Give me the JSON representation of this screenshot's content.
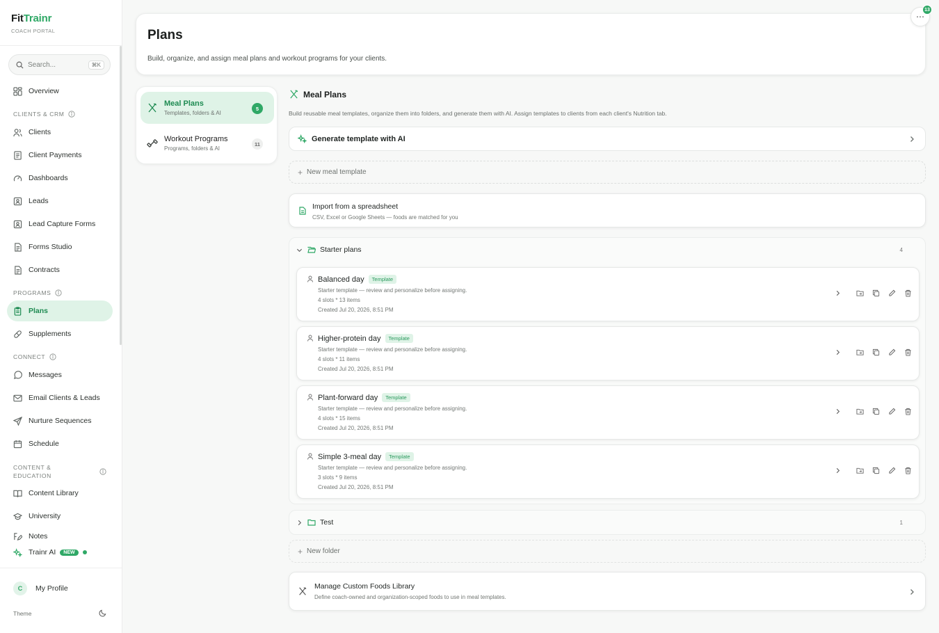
{
  "brand": {
    "name_part1": "Fit",
    "name_part2": "Trainr",
    "subtitle": "COACH PORTAL",
    "accent_color": "#2fa866"
  },
  "search": {
    "placeholder": "Search...",
    "shortcut": "⌘K"
  },
  "sidebar": {
    "overview": "Overview",
    "section_clients": "CLIENTS & CRM",
    "clients_items": [
      "Clients",
      "Client Payments",
      "Dashboards",
      "Leads",
      "Lead Capture Forms",
      "Forms Studio",
      "Contracts"
    ],
    "section_programs": "PROGRAMS",
    "programs_items": [
      "Plans",
      "Supplements"
    ],
    "section_connect": "CONNECT",
    "connect_items": [
      "Messages",
      "Email Clients & Leads",
      "Nurture Sequences",
      "Schedule"
    ],
    "section_content_line1": "CONTENT &",
    "section_content_line2": "EDUCATION",
    "content_items": [
      "Content Library",
      "University",
      "Notes"
    ],
    "trainr_ai": "Trainr AI",
    "new_badge": "NEW",
    "profile_initial": "C",
    "profile_label": "My Profile",
    "theme_label": "Theme"
  },
  "header": {
    "title": "Plans",
    "subtitle": "Build, organize, and assign meal plans and workout programs for your clients.",
    "more_icon": "ellipsis-icon",
    "notification_count": "13"
  },
  "tabs": [
    {
      "label": "Meal Plans",
      "sub": "Templates, folders & AI",
      "count": "5",
      "icon": "utensils-icon"
    },
    {
      "label": "Workout Programs",
      "sub": "Programs, folders & AI",
      "count": "11",
      "icon": "dumbbell-icon"
    }
  ],
  "main": {
    "title": "Meal Plans",
    "description": "Build reusable meal templates, organize them into folders, and generate them with AI. Assign templates to clients from each client's Nutrition tab.",
    "generate_ai": "Generate template with AI",
    "new_template": "New meal template",
    "import_title": "Import from a spreadsheet",
    "import_sub": "CSV, Excel or Google Sheets — foods are matched for you",
    "folders": [
      {
        "name": "Starter plans",
        "count": "4"
      },
      {
        "name": "Test",
        "count": "1"
      }
    ],
    "templates": [
      {
        "name": "Balanced day",
        "tag": "Template",
        "desc": "Starter template — review and personalize before assigning.",
        "meta": "4 slots * 13 items",
        "created": "Created Jul 20, 2026, 8:51 PM"
      },
      {
        "name": "Higher-protein day",
        "tag": "Template",
        "desc": "Starter template — review and personalize before assigning.",
        "meta": "4 slots * 11 items",
        "created": "Created Jul 20, 2026, 8:51 PM"
      },
      {
        "name": "Plant-forward day",
        "tag": "Template",
        "desc": "Starter template — review and personalize before assigning.",
        "meta": "4 slots * 15 items",
        "created": "Created Jul 20, 2026, 8:51 PM"
      },
      {
        "name": "Simple 3-meal day",
        "tag": "Template",
        "desc": "Starter template — review and personalize before assigning.",
        "meta": "3 slots * 9 items",
        "created": "Created Jul 20, 2026, 8:51 PM"
      }
    ],
    "new_folder": "New folder",
    "custom_foods_title": "Manage Custom Foods Library",
    "custom_foods_sub": "Define coach-owned and organization-scoped foods to use in meal templates."
  }
}
